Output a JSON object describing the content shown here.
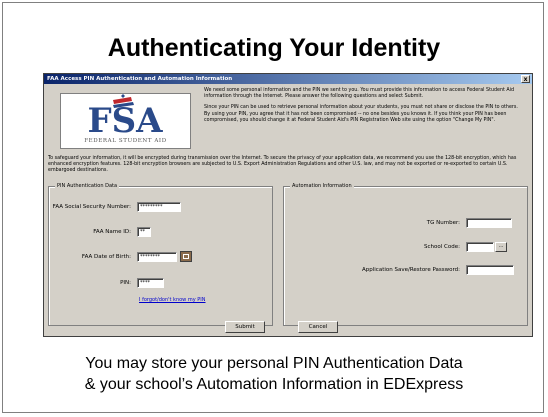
{
  "slide": {
    "title": "Authenticating Your Identity",
    "caption_line1": "You may store your personal PIN Authentication Data",
    "caption_line2": "& your school’s Automation Information in EDExpress"
  },
  "dialog": {
    "title": "FAA Access PIN Authentication and Automation Information",
    "close_label": "x",
    "logo": {
      "letters": "FSA",
      "subtitle": "FEDERAL STUDENT AID"
    },
    "intro_p1": "We need some personal information and the PIN we sent to you. You must provide this information to access Federal Student Aid information through the Internet. Please answer the following questions and select Submit.",
    "intro_p2": "Since your PIN can be used to retrieve personal information about your students, you must not share or disclose the PIN to others. By using your PIN, you agree that it has not been compromised -- no one besides you knows it. If you think your PIN has been compromised, you should change it at Federal Student Aid's PIN Registration Web site using the option \"Change My PIN\".",
    "safeguard": "To safeguard your information, it will be encrypted during transmission over the Internet. To secure the privacy of your application data, we recommend you use the 128-bit encryption, which has enhanced encryption features. 128-bit encryption browsers are subjected to U.S. Export Administration Regulations and other U.S. law, and may not be exported or re-exported to certain U.S. embargoed destinations.",
    "pin_group": {
      "legend": "PIN Authentication Data",
      "ssn_label": "FAA Social Security Number:",
      "ssn_value": "*********",
      "name_id_label": "FAA Name ID:",
      "name_id_value": "**",
      "dob_label": "FAA Date of Birth:",
      "dob_value": "********",
      "pin_label": "PIN:",
      "pin_value": "****",
      "forgot_link": "I forgot/don't know my PIN"
    },
    "automation_group": {
      "legend": "Automation Information",
      "tg_label": "TG Number:",
      "tg_value": "",
      "school_label": "School Code:",
      "school_value": "",
      "browse_label": "...",
      "password_label": "Application Save/Restore Password:",
      "password_value": ""
    },
    "submit_label": "Submit",
    "cancel_label": "Cancel"
  },
  "colors": {
    "titlebar_start": "#0a246a",
    "dialog_bg": "#d4d0c8",
    "logo_blue": "#2a4a8a",
    "logo_red": "#c0282d"
  }
}
